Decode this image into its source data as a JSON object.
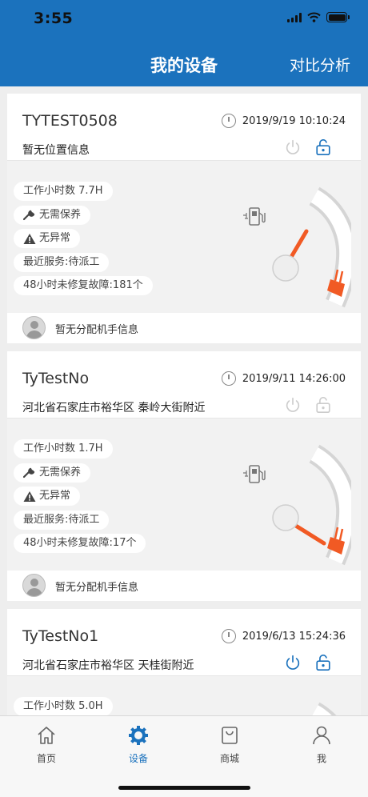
{
  "status_bar": {
    "time": "3:55"
  },
  "header": {
    "title": "我的设备",
    "action": "对比分析"
  },
  "devices": [
    {
      "name": "TYTEST0508",
      "time": "2019/9/19 10:10:24",
      "location": "暂无位置信息",
      "work_hours": "工作小时数 7.7H",
      "maintenance": "无需保养",
      "abnormal": "无异常",
      "service": "最近服务:待派工",
      "faults": "48小时未修复故障:181个",
      "mechanic": "暂无分配机手信息",
      "power_active": false,
      "lock_active": true,
      "gauge_level": 0.8
    },
    {
      "name": "TyTestNo",
      "time": "2019/9/11 14:26:00",
      "location": "河北省石家庄市裕华区 秦岭大街附近",
      "work_hours": "工作小时数 1.7H",
      "maintenance": "无需保养",
      "abnormal": "无异常",
      "service": "最近服务:待派工",
      "faults": "48小时未修复故障:17个",
      "mechanic": "暂无分配机手信息",
      "power_active": false,
      "lock_active": false,
      "gauge_level": 0.18
    },
    {
      "name": "TyTestNo1",
      "time": "2019/6/13 15:24:36",
      "location": "河北省石家庄市裕华区 天桂街附近",
      "work_hours": "工作小时数 5.0H",
      "power_active": true,
      "lock_active": true
    }
  ],
  "tabs": [
    {
      "label": "首页",
      "icon": "home-icon",
      "active": false
    },
    {
      "label": "设备",
      "icon": "gear-icon",
      "active": true
    },
    {
      "label": "商城",
      "icon": "shopping-bag-icon",
      "active": false
    },
    {
      "label": "我",
      "icon": "person-icon",
      "active": false
    }
  ],
  "colors": {
    "primary": "#1b72bd",
    "accent": "#f15a24",
    "inactive": "#cccccc"
  }
}
